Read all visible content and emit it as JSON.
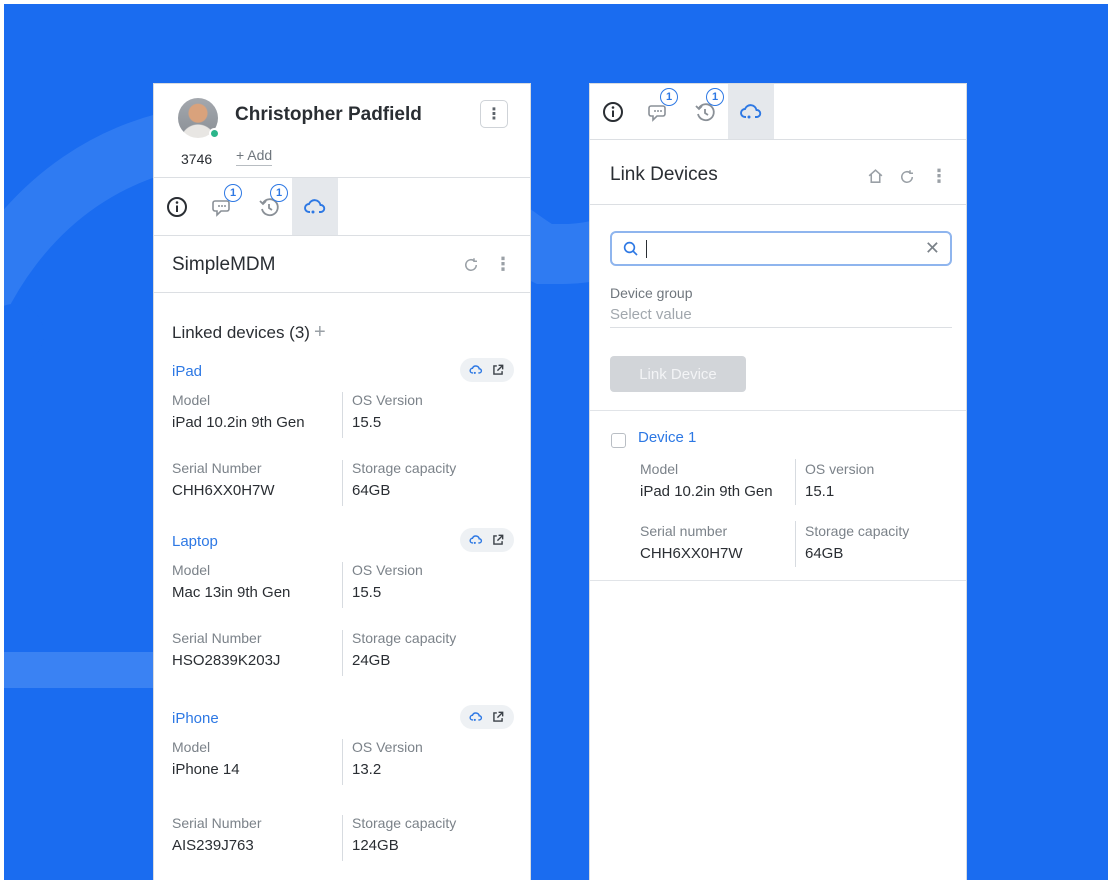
{
  "colors": {
    "background": "#1a6cf0",
    "accent": "#2d78e4",
    "online": "#2bb58a"
  },
  "contact": {
    "name": "Christopher Padfield",
    "id": "3746",
    "add_label": "+ Add",
    "more": "⋮"
  },
  "tabs": [
    {
      "name": "info-icon",
      "badge": ""
    },
    {
      "name": "chat-icon",
      "badge": "1"
    },
    {
      "name": "history-icon",
      "badge": "1"
    },
    {
      "name": "cloud-icon",
      "badge": "",
      "active": true
    }
  ],
  "simplemdm": {
    "title": "SimpleMDM",
    "linked_label": "Linked devices (3)",
    "add_icon": "+",
    "devices": [
      {
        "name": "iPad",
        "model_label": "Model",
        "model": "iPad 10.2in 9th Gen",
        "os_label": "OS Version",
        "os": "15.5",
        "serial_label": "Serial Number",
        "serial": "CHH6XX0H7W",
        "storage_label": "Storage capacity",
        "storage": "64GB"
      },
      {
        "name": "Laptop",
        "model_label": "Model",
        "model": "Mac 13in 9th Gen",
        "os_label": "OS Version",
        "os": "15.5",
        "serial_label": "Serial Number",
        "serial": "HSO2839K203J",
        "storage_label": "Storage capacity",
        "storage": "24GB"
      },
      {
        "name": "iPhone",
        "model_label": "Model",
        "model": "iPhone 14",
        "os_label": "OS Version",
        "os": "13.2",
        "serial_label": "Serial Number",
        "serial": "AIS239J763",
        "storage_label": "Storage capacity",
        "storage": "124GB"
      }
    ]
  },
  "link_devices": {
    "title": "Link Devices",
    "search_value": "",
    "device_group_label": "Device group",
    "device_group_placeholder": "Select value",
    "button_label": "Link Device",
    "result": {
      "name": "Device 1",
      "model_label": "Model",
      "model": "iPad 10.2in 9th Gen",
      "os_label": "OS version",
      "os": "15.1",
      "serial_label": "Serial number",
      "serial": "CHH6XX0H7W",
      "storage_label": "Storage capacity",
      "storage": "64GB"
    }
  }
}
